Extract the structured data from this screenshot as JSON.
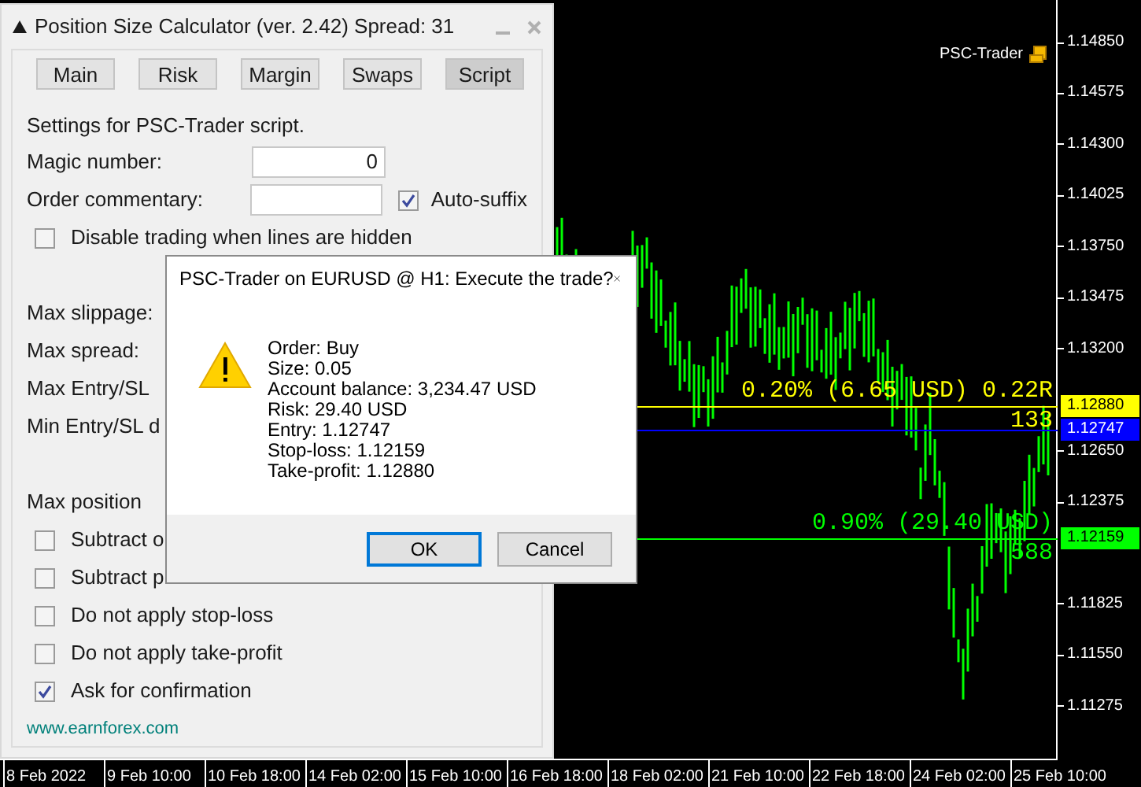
{
  "panel": {
    "title": "Position Size Calculator (ver. 2.42) Spread: 31",
    "tabs": [
      {
        "label": "Main",
        "selected": false
      },
      {
        "label": "Risk",
        "selected": false
      },
      {
        "label": "Margin",
        "selected": false
      },
      {
        "label": "Swaps",
        "selected": false
      },
      {
        "label": "Script",
        "selected": true
      }
    ],
    "intro": "Settings for PSC-Trader script.",
    "sections": [
      [
        {
          "kind": "input",
          "label": "Magic number:",
          "value": "0"
        },
        {
          "kind": "input-check",
          "label": "Order commentary:",
          "check_label": "Auto-suffix",
          "checked": true
        },
        {
          "kind": "check",
          "label": "Disable trading when lines are hidden",
          "checked": false
        }
      ],
      [
        {
          "kind": "label",
          "label": "Max slippage:"
        },
        {
          "kind": "label",
          "label": "Max spread:"
        },
        {
          "kind": "label",
          "label": "Max Entry/SL"
        },
        {
          "kind": "label",
          "label": "Min Entry/SL d"
        }
      ],
      [
        {
          "kind": "label",
          "label": "Max position"
        },
        {
          "kind": "check",
          "label": "Subtract o",
          "checked": false
        },
        {
          "kind": "check",
          "label": "Subtract p",
          "checked": false
        },
        {
          "kind": "check",
          "label": "Do not apply stop-loss",
          "checked": false
        },
        {
          "kind": "check",
          "label": "Do not apply take-profit",
          "checked": false
        },
        {
          "kind": "check",
          "label": "Ask for confirmation",
          "checked": true
        }
      ]
    ],
    "link": "www.earnforex.com"
  },
  "chart": {
    "label": "PSC-Trader",
    "price_labels": [
      "1.14850",
      "1.14575",
      "1.14300",
      "1.14025",
      "1.13750",
      "1.13475",
      "1.13200",
      "1.12650",
      "1.12375",
      "1.11825",
      "1.11550",
      "1.11275"
    ],
    "levels": [
      {
        "price": "1.12880",
        "color": "#ffff00",
        "info": "0.20% (6.65 USD) 0.22R",
        "points": "133"
      },
      {
        "price": "1.12747",
        "color": "#0000ff"
      },
      {
        "price": "1.12159",
        "color": "#00ff00",
        "info": "0.90% (29.40 USD)",
        "points": "588"
      }
    ],
    "time_labels": [
      "8 Feb 2022",
      "9 Feb 10:00",
      "10 Feb 18:00",
      "14 Feb 02:00",
      "15 Feb 10:00",
      "16 Feb 18:00",
      "18 Feb 02:00",
      "21 Feb 10:00",
      "22 Feb 18:00",
      "24 Feb 02:00",
      "25 Feb 10:00"
    ]
  },
  "dialog": {
    "title": "PSC-Trader on EURUSD @ H1: Execute the trade?",
    "lines": [
      "Order: Buy",
      "Size: 0.05",
      "Account balance: 3,234.47 USD",
      "Risk: 29.40 USD",
      "Entry: 1.12747",
      "Stop-loss: 1.12159",
      "Take-profit: 1.12880"
    ],
    "buttons": [
      {
        "label": "OK",
        "selected": true
      },
      {
        "label": "Cancel",
        "selected": false
      }
    ]
  }
}
